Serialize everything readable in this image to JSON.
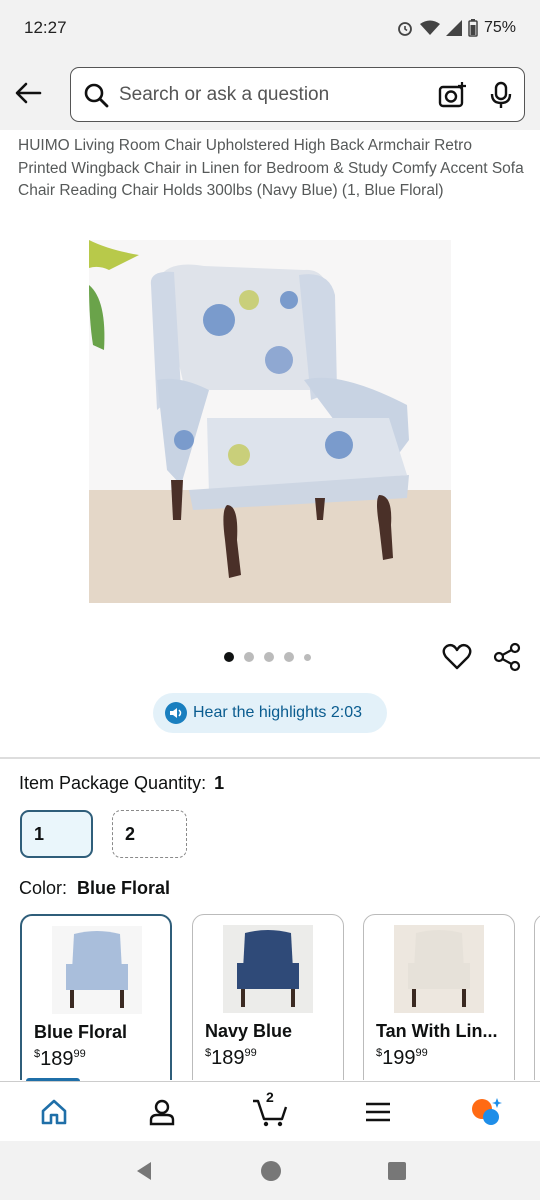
{
  "status_bar": {
    "time": "12:27",
    "battery": "75%"
  },
  "search": {
    "placeholder": "Search or ask a question"
  },
  "product": {
    "title": "HUIMO Living Room Chair Upholstered High Back Armchair Retro Printed Wingback Chair in Linen for Bedroom & Study Comfy Accent Sofa Chair Reading Chair Holds 300lbs (Navy Blue) (1, Blue Floral)"
  },
  "highlights": {
    "label": "Hear the highlights 2:03"
  },
  "quantity": {
    "label": "Item Package Quantity:",
    "selected": "1",
    "options": [
      "1",
      "2"
    ]
  },
  "color": {
    "label": "Color:",
    "selected": "Blue Floral",
    "options": [
      {
        "name": "Blue Floral",
        "dollars": "189",
        "cents": "99",
        "chair_color": "#a9bedb"
      },
      {
        "name": "Navy Blue",
        "dollars": "189",
        "cents": "99",
        "chair_color": "#2f4a78"
      },
      {
        "name": "Tan With Lin...",
        "dollars": "199",
        "cents": "99",
        "chair_color": "#e6e1d9"
      }
    ]
  },
  "cart": {
    "count": "2"
  },
  "colors": {
    "accent": "#2f5e7a",
    "link": "#0a5c8f",
    "highlight_bg": "#e3f1f9"
  }
}
